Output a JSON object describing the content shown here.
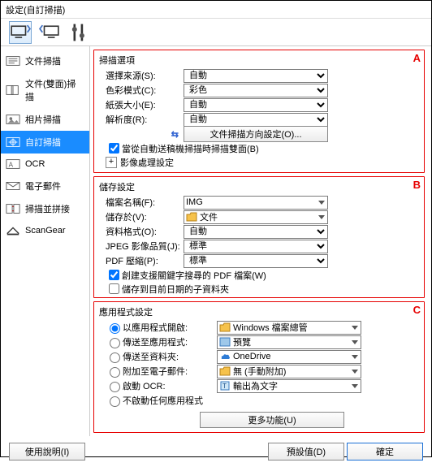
{
  "title": "設定(自訂掃描)",
  "sidebar": {
    "items": [
      {
        "label": "文件掃描"
      },
      {
        "label": "文件(雙面)掃描"
      },
      {
        "label": "相片掃描"
      },
      {
        "label": "自訂掃描"
      },
      {
        "label": "OCR"
      },
      {
        "label": "電子郵件"
      },
      {
        "label": "掃描並拼接"
      },
      {
        "label": "ScanGear"
      }
    ]
  },
  "sectionA": {
    "title": "掃描選項",
    "letter": "A",
    "rows": {
      "source": {
        "label": "選擇來源(S):",
        "value": "自動"
      },
      "colorMode": {
        "label": "色彩模式(C):",
        "value": "彩色"
      },
      "paper": {
        "label": "紙張大小(E):",
        "value": "自動"
      },
      "res": {
        "label": "解析度(R):",
        "value": "自動"
      }
    },
    "orientBtn": "文件掃描方向設定(O)...",
    "chk1": "當從自動送稿機掃描時掃描雙面(B)",
    "expand": "影像處理設定"
  },
  "sectionB": {
    "title": "儲存設定",
    "letter": "B",
    "rows": {
      "fname": {
        "label": "檔案名稱(F):",
        "value": "IMG"
      },
      "saveIn": {
        "label": "儲存於(V):",
        "value": "文件"
      },
      "fmt": {
        "label": "資料格式(O):",
        "value": "自動"
      },
      "jpeg": {
        "label": "JPEG 影像品質(J):",
        "value": "標準"
      },
      "pdf": {
        "label": "PDF 壓縮(P):",
        "value": "標準"
      }
    },
    "chk1": "創建支援關鍵字搜尋的 PDF 檔案(W)",
    "chk2": "儲存到目前日期的子資料夾"
  },
  "sectionC": {
    "title": "應用程式設定",
    "letter": "C",
    "radios": {
      "r1": {
        "label": "以應用程式開啟:",
        "value": "Windows 檔案總管"
      },
      "r2": {
        "label": "傳送至應用程式:",
        "value": "預覽"
      },
      "r3": {
        "label": "傳送至資料夾:",
        "value": "OneDrive"
      },
      "r4": {
        "label": "附加至電子郵件:",
        "value": "無 (手動附加)"
      },
      "r5": {
        "label": "啟動 OCR:",
        "value": "輸出為文字"
      },
      "r6": {
        "label": "不啟動任何應用程式"
      }
    },
    "moreBtn": "更多功能(U)"
  },
  "footer": {
    "help": "使用說明(I)",
    "defaults": "預設值(D)",
    "ok": "確定"
  }
}
